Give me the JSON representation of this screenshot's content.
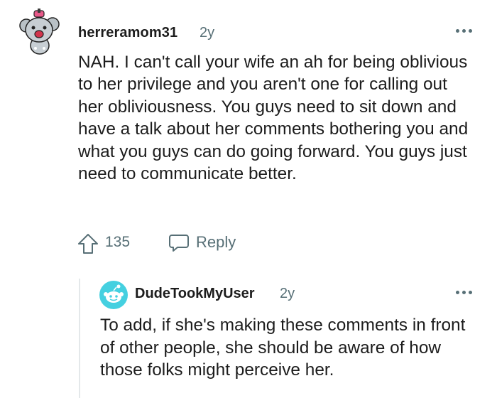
{
  "main_comment": {
    "username": "herreramom31",
    "age": "2y",
    "avatar_icon": "snoo-avatar-icon",
    "text": "NAH. I can't call your wife an ah for being oblivious to her privilege and you aren't one for calling out her obliviousness. You guys need to sit down and have a talk about her comments bothering you and what you guys can do going forward. You guys just need to communicate better.",
    "score": "135",
    "reply_label": "Reply"
  },
  "reply_comment": {
    "username": "DudeTookMyUser",
    "age": "2y",
    "avatar_icon": "default-snoo-icon",
    "text": "To add, if she's making these comments in front of other people, she should be aware of how those folks might perceive her."
  },
  "colors": {
    "text": "#1c1c1c",
    "meta": "#576f76",
    "thread_line": "#e4e8ea",
    "reply_avatar_bg": "#45d0e0"
  }
}
